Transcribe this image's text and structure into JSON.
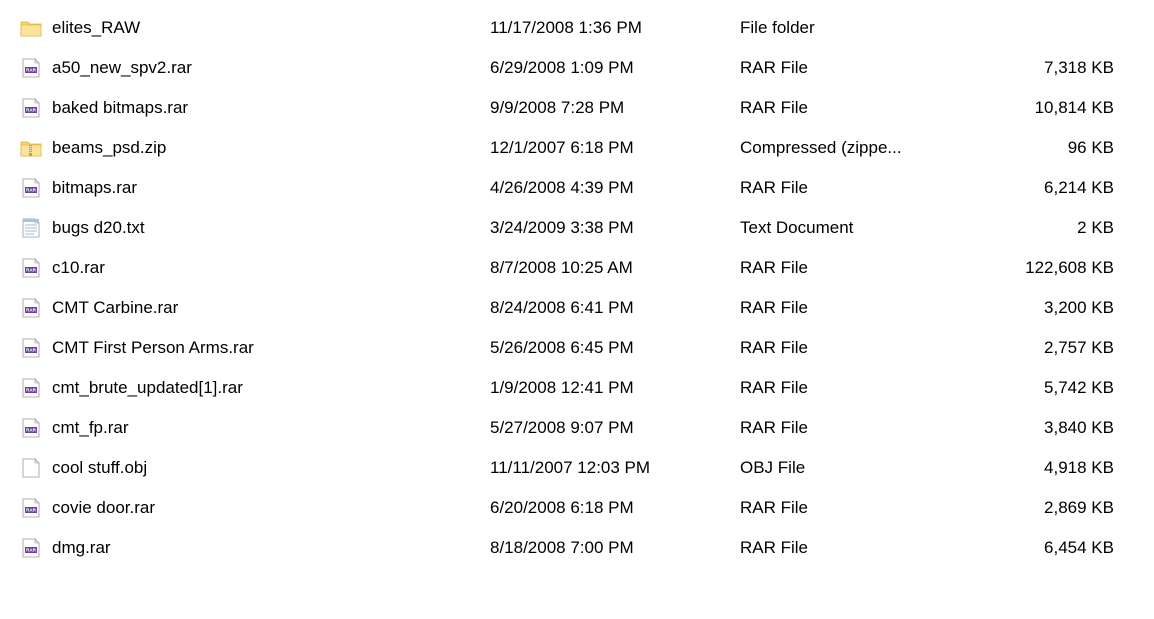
{
  "files": [
    {
      "name": "elites_RAW",
      "date": "11/17/2008 1:36 PM",
      "type": "File folder",
      "size": "",
      "icon": "folder"
    },
    {
      "name": "a50_new_spv2.rar",
      "date": "6/29/2008 1:09 PM",
      "type": "RAR File",
      "size": "7,318 KB",
      "icon": "rar"
    },
    {
      "name": "baked bitmaps.rar",
      "date": "9/9/2008 7:28 PM",
      "type": "RAR File",
      "size": "10,814 KB",
      "icon": "rar"
    },
    {
      "name": "beams_psd.zip",
      "date": "12/1/2007 6:18 PM",
      "type": "Compressed (zippe...",
      "size": "96 KB",
      "icon": "zip"
    },
    {
      "name": "bitmaps.rar",
      "date": "4/26/2008 4:39 PM",
      "type": "RAR File",
      "size": "6,214 KB",
      "icon": "rar"
    },
    {
      "name": "bugs d20.txt",
      "date": "3/24/2009 3:38 PM",
      "type": "Text Document",
      "size": "2 KB",
      "icon": "txt"
    },
    {
      "name": "c10.rar",
      "date": "8/7/2008 10:25 AM",
      "type": "RAR File",
      "size": "122,608 KB",
      "icon": "rar"
    },
    {
      "name": "CMT Carbine.rar",
      "date": "8/24/2008 6:41 PM",
      "type": "RAR File",
      "size": "3,200 KB",
      "icon": "rar"
    },
    {
      "name": "CMT First Person Arms.rar",
      "date": "5/26/2008 6:45 PM",
      "type": "RAR File",
      "size": "2,757 KB",
      "icon": "rar"
    },
    {
      "name": "cmt_brute_updated[1].rar",
      "date": "1/9/2008 12:41 PM",
      "type": "RAR File",
      "size": "5,742 KB",
      "icon": "rar"
    },
    {
      "name": "cmt_fp.rar",
      "date": "5/27/2008 9:07 PM",
      "type": "RAR File",
      "size": "3,840 KB",
      "icon": "rar"
    },
    {
      "name": "cool stuff.obj",
      "date": "11/11/2007 12:03 PM",
      "type": "OBJ File",
      "size": "4,918 KB",
      "icon": "blank"
    },
    {
      "name": "covie door.rar",
      "date": "6/20/2008 6:18 PM",
      "type": "RAR File",
      "size": "2,869 KB",
      "icon": "rar"
    },
    {
      "name": "dmg.rar",
      "date": "8/18/2008 7:00 PM",
      "type": "RAR File",
      "size": "6,454 KB",
      "icon": "rar"
    }
  ]
}
